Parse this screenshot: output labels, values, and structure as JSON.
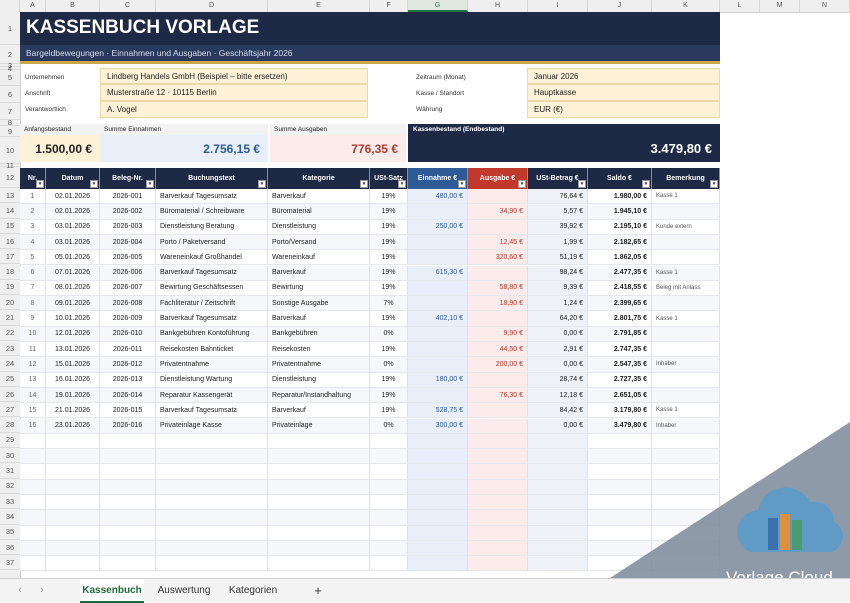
{
  "columns": [
    "A",
    "B",
    "C",
    "D",
    "E",
    "F",
    "G",
    "H",
    "I",
    "J",
    "K",
    "L",
    "M",
    "N"
  ],
  "title": "KASSENBUCH VORLAGE",
  "subtitle": "Bargeldbewegungen · Einnahmen und Ausgaben · Geschäftsjahr 2026",
  "info_left": [
    {
      "label": "Unternehmen",
      "value": "Lindberg Handels GmbH  (Beispiel – bitte ersetzen)"
    },
    {
      "label": "Anschrift",
      "value": "Musterstraße 12 · 10115 Berlin"
    },
    {
      "label": "Verantwortlich",
      "value": "A. Vogel"
    }
  ],
  "info_right": [
    {
      "label": "Zeitraum (Monat)",
      "value": "Januar 2026"
    },
    {
      "label": "Kasse / Standort",
      "value": "Hauptkasse"
    },
    {
      "label": "Währung",
      "value": "EUR (€)"
    }
  ],
  "summary": {
    "anfang_label": "Anfangsbestand",
    "anfang_value": "1.500,00 €",
    "ein_label": "Summe Einnahmen",
    "ein_value": "2.756,15 €",
    "aus_label": "Summe Ausgaben",
    "aus_value": "776,35 €",
    "end_label": "Kassenbestand (Endbestand)",
    "end_value": "3.479,80 €"
  },
  "headers": [
    "Nr.",
    "Datum",
    "Beleg-Nr.",
    "Buchungstext",
    "Kategorie",
    "USt-Satz",
    "Einnahme €",
    "Ausgabe €",
    "USt-Betrag €",
    "Saldo €",
    "Bemerkung"
  ],
  "rows": [
    [
      "1",
      "02.01.2026",
      "2026-001",
      "Barverkauf Tagesumsatz",
      "Barverkauf",
      "19%",
      "480,00 €",
      "",
      "76,64 €",
      "1.980,00 €",
      "Kasse 1"
    ],
    [
      "2",
      "02.01.2026",
      "2026-002",
      "Büromaterial / Schreibware",
      "Büromaterial",
      "19%",
      "",
      "34,90 €",
      "5,57 €",
      "1.945,10 €",
      ""
    ],
    [
      "3",
      "03.01.2026",
      "2026-003",
      "Dienstleistung Beratung",
      "Dienstleistung",
      "19%",
      "250,00 €",
      "",
      "39,92 €",
      "2.195,10 €",
      "Kunde extern"
    ],
    [
      "4",
      "03.01.2026",
      "2026-004",
      "Porto / Paketversand",
      "Porto/Versand",
      "19%",
      "",
      "12,45 €",
      "1,99 €",
      "2.182,65 €",
      ""
    ],
    [
      "5",
      "05.01.2026",
      "2026-005",
      "Wareneinkauf Großhandel",
      "Wareneinkauf",
      "19%",
      "",
      "320,60 €",
      "51,19 €",
      "1.862,05 €",
      ""
    ],
    [
      "6",
      "07.01.2026",
      "2026-006",
      "Barverkauf Tagesumsatz",
      "Barverkauf",
      "19%",
      "615,30 €",
      "",
      "98,24 €",
      "2.477,35 €",
      "Kasse 1"
    ],
    [
      "7",
      "08.01.2026",
      "2026-007",
      "Bewirtung Geschäftsessen",
      "Bewirtung",
      "19%",
      "",
      "58,80 €",
      "9,39 €",
      "2.418,55 €",
      "Beleg mit Anlass"
    ],
    [
      "8",
      "09.01.2026",
      "2026-008",
      "Fachliteratur / Zeitschrift",
      "Sonstige Ausgabe",
      "7%",
      "",
      "18,90 €",
      "1,24 €",
      "2.399,65 €",
      ""
    ],
    [
      "9",
      "10.01.2026",
      "2026-009",
      "Barverkauf Tagesumsatz",
      "Barverkauf",
      "19%",
      "402,10 €",
      "",
      "64,20 €",
      "2.801,75 €",
      "Kasse 1"
    ],
    [
      "10",
      "12.01.2026",
      "2026-010",
      "Bankgebühren Kontoführung",
      "Bankgebühren",
      "0%",
      "",
      "9,90 €",
      "0,00 €",
      "2.791,85 €",
      ""
    ],
    [
      "11",
      "13.01.2026",
      "2026-011",
      "Reisekosten Bahnticket",
      "Reisekosten",
      "19%",
      "",
      "44,50 €",
      "2,91 €",
      "2.747,35 €",
      ""
    ],
    [
      "12",
      "15.01.2026",
      "2026-012",
      "Privatentnahme",
      "Privatentnahme",
      "0%",
      "",
      "200,00 €",
      "0,00 €",
      "2.547,35 €",
      "Inhaber"
    ],
    [
      "13",
      "16.01.2026",
      "2026-013",
      "Dienstleistung Wartung",
      "Dienstleistung",
      "19%",
      "180,00 €",
      "",
      "28,74 €",
      "2.727,35 €",
      ""
    ],
    [
      "14",
      "19.01.2026",
      "2026-014",
      "Reparatur Kassengerät",
      "Reparatur/Instandhaltung",
      "19%",
      "",
      "76,30 €",
      "12,18 €",
      "2.651,05 €",
      ""
    ],
    [
      "15",
      "21.01.2026",
      "2026-015",
      "Barverkauf Tagesumsatz",
      "Barverkauf",
      "19%",
      "528,75 €",
      "",
      "84,42 €",
      "3.179,80 €",
      "Kasse 1"
    ],
    [
      "16",
      "23.01.2026",
      "2026-016",
      "Privateinlage Kasse",
      "Privateinlage",
      "0%",
      "300,00 €",
      "",
      "0,00 €",
      "3.479,80 €",
      "Inhaber"
    ]
  ],
  "sheet_tabs": [
    "Kassenbuch",
    "Auswertung",
    "Kategorien"
  ],
  "add_sheet": "+",
  "watermark": "Vorlage Cloud",
  "colors": {
    "navy": "#1e2a45",
    "header_blue": "#2d5b96",
    "header_red": "#c0392b",
    "income_fill": "#e8eff8",
    "expense_fill": "#fbeceb",
    "info_fill": "#fdf2d8",
    "gold": "#c9a646"
  }
}
